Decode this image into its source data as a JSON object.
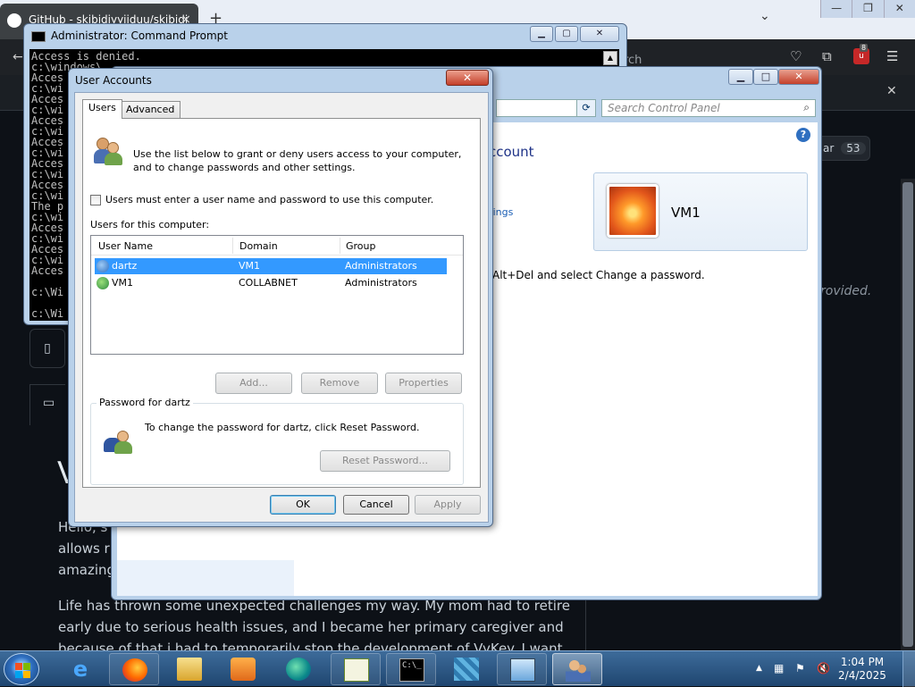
{
  "browser": {
    "tab_title": "GitHub - skibidiyyiiduu/skibidi",
    "tab_close": "×",
    "new_tab": "+",
    "tabs_menu": "⌄",
    "win_min": "—",
    "win_max": "❐",
    "win_close": "✕",
    "back": "←",
    "search_hint": "arch",
    "ext_badge": "8",
    "notif_close": "✕",
    "star_label": "ar",
    "star_count": "53",
    "provided_text": "rovided.",
    "heading_fragment": "V",
    "para1": "Hello, s... allows ru... amazing",
    "para1_lines": [
      "Hello, s",
      "allows ru",
      "amazing"
    ],
    "para2_lines": [
      "Life has thrown some unexpected challenges my way. My mom had to retire",
      "early due to serious health issues, and I became her primary caregiver and",
      "because of that i had to temporarily stop the development of VyKey. I want to"
    ]
  },
  "cmd": {
    "title": "Administrator: Command Prompt",
    "scroll_up": "▲",
    "lines": [
      "Access is denied.",
      "c:\\windows\\",
      "Acces",
      "c:\\wi",
      "Acces",
      "c:\\wi",
      "Acces",
      "c:\\wi",
      "Acces",
      "c:\\wi",
      "Acces",
      "c:\\wi",
      "Acces",
      "c:\\wi",
      "The p",
      "c:\\wi",
      "Acces",
      "c:\\wi",
      "Acces",
      "c:\\wi",
      "Acces",
      "",
      "c:\\Wi",
      "",
      "c:\\Wi"
    ]
  },
  "control_panel": {
    "search_placeholder": "Search Control Panel",
    "heading": "ccount",
    "link_text": "ttings",
    "hint_text": "Alt+Del and select Change a password.",
    "account_name": "VM1",
    "help": "?"
  },
  "user_accounts": {
    "title": "User Accounts",
    "close": "✕",
    "tabs": [
      {
        "label": "Users",
        "selected": true
      },
      {
        "label": "Advanced",
        "selected": false
      }
    ],
    "intro_line1": "Use the list below to grant or deny users access to your computer,",
    "intro_line2": "and to change passwords and other settings.",
    "require_password_label": "Users must enter a user name and password to use this computer.",
    "require_password_checked": false,
    "users_label": "Users for this computer:",
    "columns": [
      "User Name",
      "Domain",
      "Group"
    ],
    "rows": [
      {
        "user": "dartz",
        "domain": "VM1",
        "group": "Administrators",
        "selected": true
      },
      {
        "user": "VM1",
        "domain": "COLLABNET",
        "group": "Administrators",
        "selected": false
      }
    ],
    "buttons": {
      "add": "Add...",
      "remove": "Remove",
      "properties": "Properties",
      "reset_password": "Reset Password...",
      "ok": "OK",
      "cancel": "Cancel",
      "apply": "Apply"
    },
    "password_group_title": "Password for dartz",
    "password_group_text": "To change the password for dartz, click Reset Password."
  },
  "taskbar": {
    "time": "1:04 PM",
    "date": "2/4/2025",
    "tray_expand": "▲",
    "pinned": [
      "internet-explorer-icon",
      "firefox-icon",
      "file-explorer-icon",
      "media-player-icon",
      "edge-icon",
      "notepad-icon",
      "command-prompt-icon",
      "rubik-icon",
      "control-panel-icon",
      "user-accounts-icon"
    ]
  }
}
